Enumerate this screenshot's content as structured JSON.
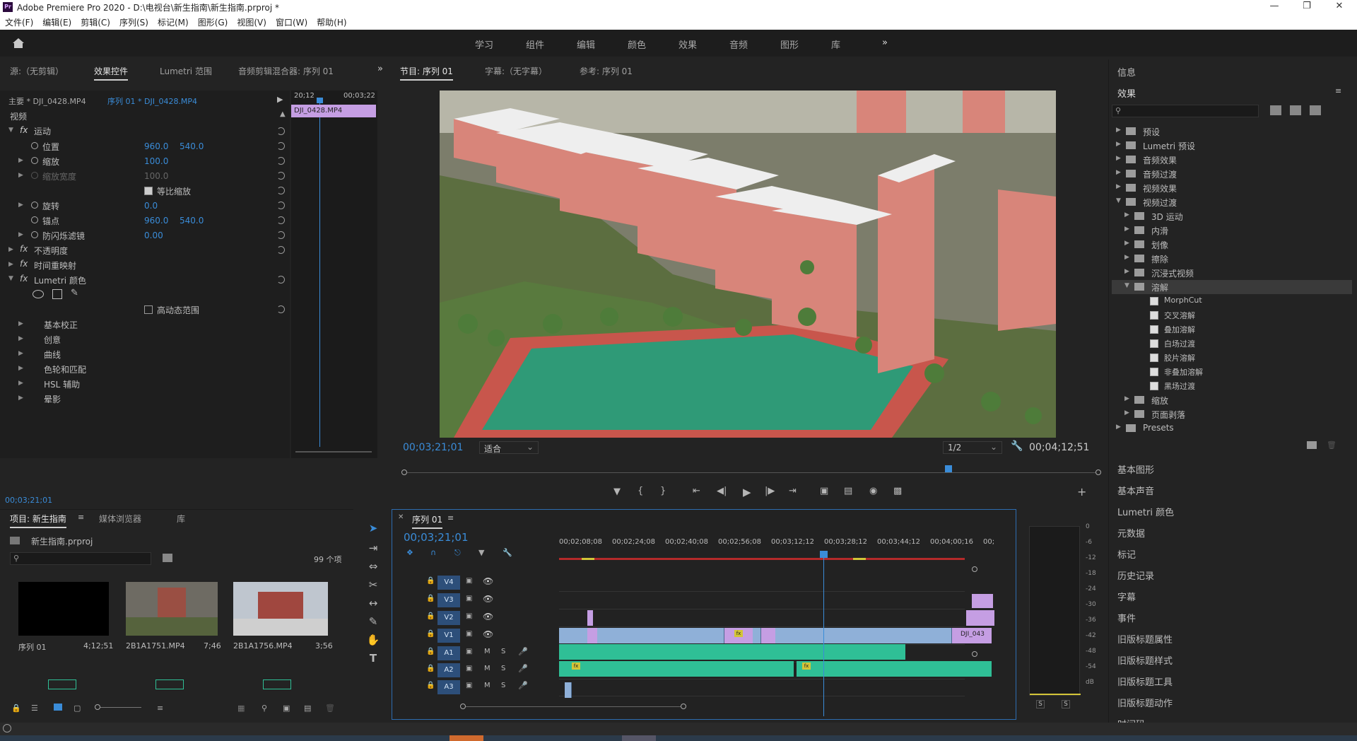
{
  "window": {
    "title": "Adobe Premiere Pro 2020 - D:\\电视台\\新生指南\\新生指南.prproj *",
    "logo": "Pr"
  },
  "menu": [
    "文件(F)",
    "编辑(E)",
    "剪辑(C)",
    "序列(S)",
    "标记(M)",
    "图形(G)",
    "视图(V)",
    "窗口(W)",
    "帮助(H)"
  ],
  "workspaces": [
    "学习",
    "组件",
    "编辑",
    "颜色",
    "效果",
    "音频",
    "图形",
    "库"
  ],
  "more_icon": "»",
  "source_panel": {
    "tabs": [
      "源:（无剪辑）",
      "效果控件",
      "Lumetri 范围",
      "音频剪辑混合器: 序列 01"
    ],
    "master": "主要 * DJI_0428.MP4",
    "seq": "序列 01 * DJI_0428.MP4",
    "time_a": "20;12",
    "time_b": "00;03;22",
    "clip": "DJI_0428.MP4",
    "video_label": "视频",
    "motion": "运动",
    "rows": [
      {
        "name": "位置",
        "v1": "960.0",
        "v2": "540.0"
      },
      {
        "name": "缩放",
        "v1": "100.0",
        "v2": ""
      },
      {
        "name": "缩放宽度",
        "v1": "100.0",
        "v2": ""
      },
      {
        "name": "等比缩放",
        "v1": "",
        "v2": ""
      },
      {
        "name": "旋转",
        "v1": "0.0",
        "v2": ""
      },
      {
        "name": "锚点",
        "v1": "960.0",
        "v2": "540.0"
      },
      {
        "name": "防闪烁滤镜",
        "v1": "0.00",
        "v2": ""
      }
    ],
    "opacity": "不透明度",
    "timeremap": "时间重映射",
    "lumetri": "Lumetri 颜色",
    "hdr": "高动态范围",
    "lumetri_items": [
      "基本校正",
      "创意",
      "曲线",
      "色轮和匹配",
      "HSL 辅助",
      "晕影"
    ],
    "timecode": "00;03;21;01"
  },
  "program_panel": {
    "tabs": [
      "节目: 序列 01",
      "字幕:（无字幕）",
      "参考: 序列 01"
    ],
    "timecode": "00;03;21;01",
    "fit": "适合",
    "res": "1/2",
    "duration": "00;04;12;51",
    "playhead": 0.79
  },
  "effects": {
    "info": "信息",
    "title": "效果",
    "items": [
      {
        "label": "预设",
        "lvl": 0
      },
      {
        "label": "Lumetri 预设",
        "lvl": 0
      },
      {
        "label": "音频效果",
        "lvl": 0
      },
      {
        "label": "音频过渡",
        "lvl": 0
      },
      {
        "label": "视频效果",
        "lvl": 0
      },
      {
        "label": "视频过渡",
        "lvl": 0
      },
      {
        "label": "3D 运动",
        "lvl": 1
      },
      {
        "label": "内滑",
        "lvl": 1
      },
      {
        "label": "划像",
        "lvl": 1
      },
      {
        "label": "擦除",
        "lvl": 1
      },
      {
        "label": "沉浸式视频",
        "lvl": 1
      },
      {
        "label": "溶解",
        "lvl": 1
      },
      {
        "label": "MorphCut",
        "lvl": 2
      },
      {
        "label": "交叉溶解",
        "lvl": 2
      },
      {
        "label": "叠加溶解",
        "lvl": 2
      },
      {
        "label": "白场过渡",
        "lvl": 2
      },
      {
        "label": "胶片溶解",
        "lvl": 2
      },
      {
        "label": "非叠加溶解",
        "lvl": 2
      },
      {
        "label": "黑场过渡",
        "lvl": 2
      },
      {
        "label": "缩放",
        "lvl": 1
      },
      {
        "label": "页面剥落",
        "lvl": 1
      },
      {
        "label": "Presets",
        "lvl": 0
      }
    ],
    "panels": [
      "基本图形",
      "基本声音",
      "Lumetri 颜色",
      "元数据",
      "标记",
      "历史记录",
      "字幕",
      "事件",
      "旧版标题属性",
      "旧版标题样式",
      "旧版标题工具",
      "旧版标题动作",
      "时间码"
    ]
  },
  "project": {
    "tabs": [
      "项目: 新生指南",
      "媒体浏览器",
      "库"
    ],
    "file": "新生指南.prproj",
    "count": "99 个项",
    "items": [
      {
        "name": "序列 01",
        "dur": "4;12;51"
      },
      {
        "name": "2B1A1751.MP4",
        "dur": "7;46"
      },
      {
        "name": "2B1A1756.MP4",
        "dur": "3;56"
      }
    ]
  },
  "timeline": {
    "tab": "序列 01",
    "timecode": "00;03;21;01",
    "ticks": [
      "00;02;08;08",
      "00;02;24;08",
      "00;02;40;08",
      "00;02;56;08",
      "00;03;12;12",
      "00;03;28;12",
      "00;03;44;12",
      "00;04;00;16",
      "00;"
    ],
    "tracks": [
      "V4",
      "V3",
      "V2",
      "V1",
      "A1",
      "A2",
      "A3"
    ],
    "clip_label": "DJI_043",
    "fx": "fx",
    "ms": [
      "M",
      "S"
    ]
  },
  "meters": {
    "labels": [
      "0",
      "-6",
      "-12",
      "-18",
      "-24",
      "-30",
      "-36",
      "-42",
      "-48",
      "-54",
      "dB"
    ],
    "s": "S"
  },
  "colors": {
    "accent": "#2d8ceb",
    "clip_blue": "#8fb0d8",
    "clip_purple": "#c59ee3",
    "audio_green": "#2fbf96"
  }
}
